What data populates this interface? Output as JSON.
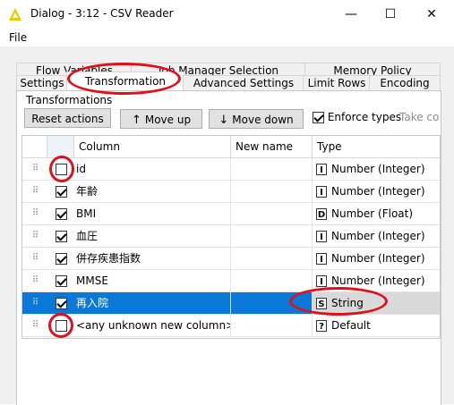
{
  "window": {
    "title": "Dialog - 3:12 - CSV Reader",
    "minimize": "—",
    "maximize": "☐",
    "close": "✕"
  },
  "menu": {
    "file": "File"
  },
  "tabs": {
    "row1": [
      "Flow Variables",
      "Job Manager Selection",
      "Memory Policy"
    ],
    "row2": [
      "Settings",
      "Transformation",
      "Advanced Settings",
      "Limit Rows",
      "Encoding"
    ]
  },
  "group": {
    "label": "Transformations"
  },
  "toolbar": {
    "reset": "Reset actions",
    "move_up": "Move up",
    "move_down": "Move down",
    "enforce_types": "Enforce types",
    "enforce_checked": true,
    "take_columns": "Take col"
  },
  "table": {
    "headers": {
      "column": "Column",
      "new_name": "New name",
      "type": "Type"
    },
    "rows": [
      {
        "name": "id",
        "new_name": "",
        "type_icon": "I",
        "type": "Number (Integer)",
        "checked": false
      },
      {
        "name": "年齢",
        "new_name": "",
        "type_icon": "I",
        "type": "Number (Integer)",
        "checked": true
      },
      {
        "name": "BMI",
        "new_name": "",
        "type_icon": "D",
        "type": "Number (Float)",
        "checked": true
      },
      {
        "name": "血圧",
        "new_name": "",
        "type_icon": "I",
        "type": "Number (Integer)",
        "checked": true
      },
      {
        "name": "併存疾患指数",
        "new_name": "",
        "type_icon": "I",
        "type": "Number (Integer)",
        "checked": true
      },
      {
        "name": "MMSE",
        "new_name": "",
        "type_icon": "I",
        "type": "Number (Integer)",
        "checked": true
      },
      {
        "name": "再入院",
        "new_name": "",
        "type_icon": "S",
        "type": "String",
        "checked": true,
        "selected": true
      },
      {
        "name": "<any unknown new column>",
        "new_name": "",
        "type_icon": "?",
        "type": "Default",
        "checked": false
      }
    ]
  },
  "colors": {
    "selection": "#0a78d7",
    "annotation": "#e0101a",
    "app_icon": "#f5c400"
  }
}
